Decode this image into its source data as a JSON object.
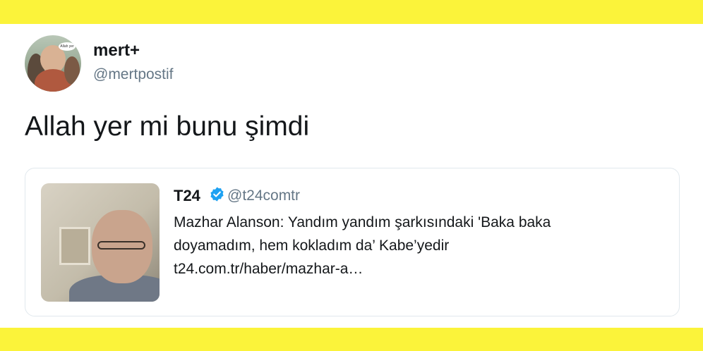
{
  "colors": {
    "band": "#fbf33a",
    "verified": "#1da1f2",
    "handle_gray": "#657786"
  },
  "tweet": {
    "avatar_icon": "user-avatar-photo",
    "avatar_bubble_text": "Allah yer",
    "display_name": "mert+",
    "handle": "@mertpostif",
    "text": "Allah yer mi bunu şimdi"
  },
  "quoted": {
    "thumbnail_icon": "news-photo-thumbnail",
    "display_name": "T24",
    "verified_icon": "verified-badge-icon",
    "handle": "@t24comtr",
    "lines": [
      "Mazhar Alanson: Yandım yandım şarkısındaki 'Baka baka",
      "doyamadım, hem kokladım da’ Kabe’yedir",
      "t24.com.tr/haber/mazhar-a…"
    ]
  }
}
